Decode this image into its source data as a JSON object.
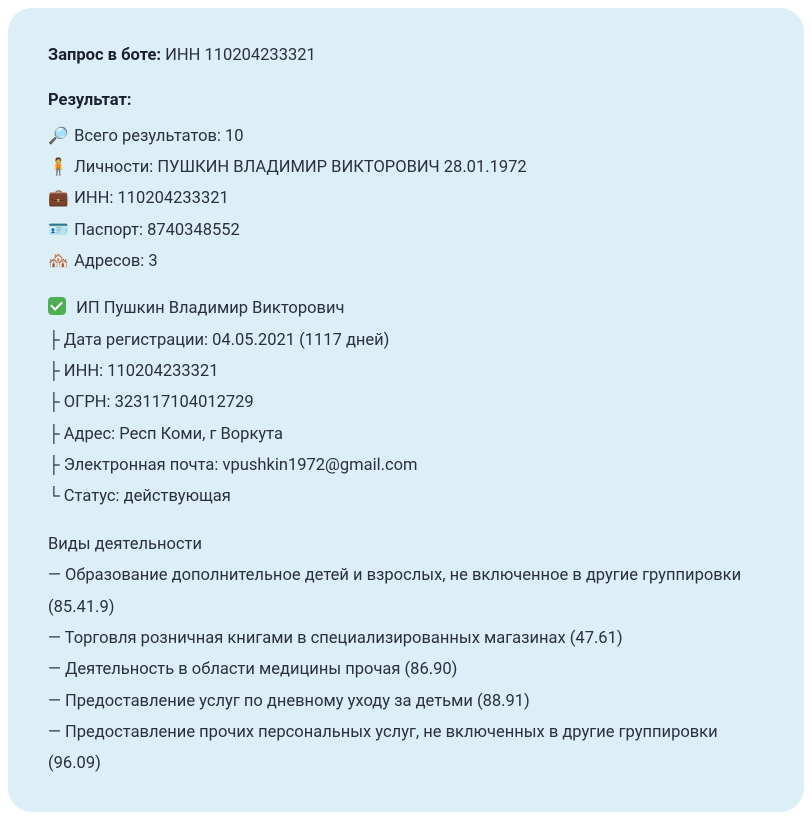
{
  "header": {
    "label": "Запрос в боте:",
    "value": "ИНН 110204233321"
  },
  "result": {
    "title": "Результат:",
    "summary": {
      "total": {
        "icon": "🔎",
        "label": "Всего результатов:",
        "value": "10"
      },
      "person": {
        "icon": "🧍",
        "label": "Личности:",
        "value": "ПУШКИН ВЛАДИМИР ВИКТОРОВИЧ 28.01.1972"
      },
      "inn": {
        "icon": "💼",
        "label": "ИНН:",
        "value": "110204233321"
      },
      "passport": {
        "icon": "🪪",
        "label": "Паспорт:",
        "value": "8740348552"
      },
      "addresses": {
        "icon": "🏘️",
        "label": "Адресов:",
        "value": "3"
      }
    },
    "entity": {
      "name": "ИП Пушкин Владимир Викторович",
      "reg_date": {
        "label": "Дата регистрации:",
        "value": "04.05.2021 (1117 дней)"
      },
      "inn": {
        "label": "ИНН:",
        "value": "110204233321"
      },
      "ogrn": {
        "label": "ОГРН:",
        "value": "323117104012729"
      },
      "address": {
        "label": "Адрес:",
        "value": "Респ Коми, г Воркута"
      },
      "email": {
        "label": "Электронная почта:",
        "value": "vpushkin1972@gmail.com"
      },
      "status": {
        "label": "Статус:",
        "value": "действующая"
      }
    },
    "activities": {
      "title": "Виды деятельности",
      "items": [
        "Образование дополнительное детей и взрослых, не включенное в другие группировки (85.41.9)",
        "Торговля розничная книгами в специализированных магазинах (47.61)",
        "Деятельность в области медицины прочая (86.90)",
        "Предоставление услуг по дневному уходу за детьми (88.91)",
        "Предоставление прочих персональных услуг, не включенных в другие группировки (96.09)"
      ]
    }
  }
}
